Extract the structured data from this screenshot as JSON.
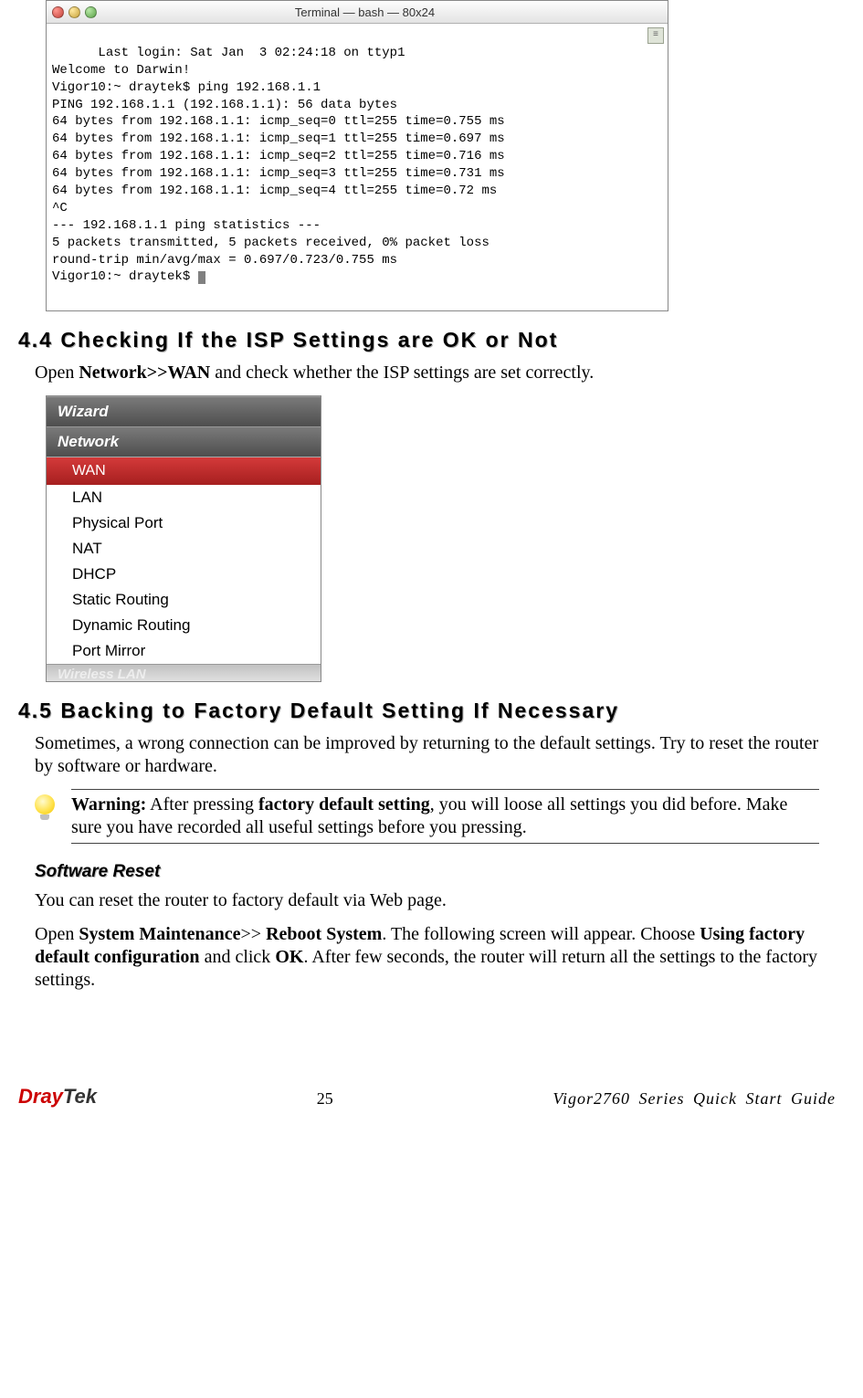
{
  "terminal": {
    "title": "Terminal — bash — 80x24",
    "lines": [
      "Last login: Sat Jan  3 02:24:18 on ttyp1",
      "Welcome to Darwin!",
      "Vigor10:~ draytek$ ping 192.168.1.1",
      "PING 192.168.1.1 (192.168.1.1): 56 data bytes",
      "64 bytes from 192.168.1.1: icmp_seq=0 ttl=255 time=0.755 ms",
      "64 bytes from 192.168.1.1: icmp_seq=1 ttl=255 time=0.697 ms",
      "64 bytes from 192.168.1.1: icmp_seq=2 ttl=255 time=0.716 ms",
      "64 bytes from 192.168.1.1: icmp_seq=3 ttl=255 time=0.731 ms",
      "64 bytes from 192.168.1.1: icmp_seq=4 ttl=255 time=0.72 ms",
      "^C",
      "--- 192.168.1.1 ping statistics ---",
      "5 packets transmitted, 5 packets received, 0% packet loss",
      "round-trip min/avg/max = 0.697/0.723/0.755 ms",
      "Vigor10:~ draytek$ "
    ]
  },
  "section44": {
    "heading": "4.4 Checking If the ISP Settings are OK or Not",
    "para_before": "Open ",
    "para_bold": "Network>>WAN",
    "para_after": " and check whether the ISP settings are set correctly."
  },
  "nav": {
    "cat_wizard": "Wizard",
    "cat_network": "Network",
    "items": [
      "WAN",
      "LAN",
      "Physical Port",
      "NAT",
      "DHCP",
      "Static Routing",
      "Dynamic Routing",
      "Port Mirror"
    ],
    "cat_faded": "Wireless LAN"
  },
  "section45": {
    "heading": "4.5 Backing to Factory Default Setting If Necessary",
    "para": "Sometimes, a wrong connection can be improved by returning to the default settings. Try to reset the router by software or hardware."
  },
  "warning": {
    "label": "Warning:",
    "before_bold": " After pressing ",
    "bold": "factory default setting",
    "after_bold": ", you will loose all settings you did before. Make sure you have recorded all useful settings before you pressing."
  },
  "software_reset": {
    "heading": "Software Reset",
    "para1": "You can reset the router to factory default via Web page.",
    "p2_a": "Open ",
    "p2_b": "System Maintenance",
    "p2_c": ">> ",
    "p2_d": "Reboot System",
    "p2_e": ". The following screen will appear. Choose ",
    "p2_f": "Using factory default configuration",
    "p2_g": " and click ",
    "p2_h": "OK",
    "p2_i": ". After few seconds, the router will return all the settings to the factory settings."
  },
  "footer": {
    "logo_d": "Dray",
    "logo_rest": "Tek",
    "page": "25",
    "guide": "Vigor2760 Series Quick Start Guide"
  }
}
